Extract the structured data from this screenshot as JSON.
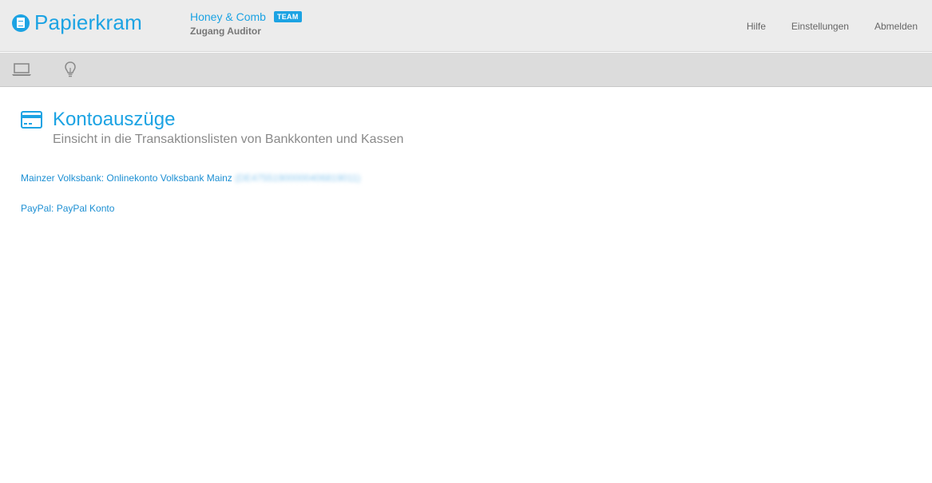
{
  "app": {
    "brand": "Papierkram",
    "company": "Honey & Comb",
    "badge": "TEAM",
    "access_level": "Zugang Auditor"
  },
  "topnav": {
    "help": "Hilfe",
    "settings": "Einstellungen",
    "logout": "Abmelden"
  },
  "toolbar": {
    "icons": [
      "laptop-icon",
      "lightbulb-icon"
    ]
  },
  "page": {
    "title": "Kontoauszüge",
    "subtitle": "Einsicht in die Transaktionslisten von Bankkonten und Kassen",
    "icon": "credit-card-icon"
  },
  "accounts": [
    {
      "label": "Mainzer Volksbank: Onlinekonto Volksbank Mainz",
      "iban": "(DE47551900000406819011)"
    },
    {
      "label": "PayPal: PayPal Konto",
      "iban": ""
    }
  ],
  "colors": {
    "accent": "#1ca3e3",
    "topbar_bg": "#ececec",
    "toolbar_bg": "#dcdcdc"
  }
}
